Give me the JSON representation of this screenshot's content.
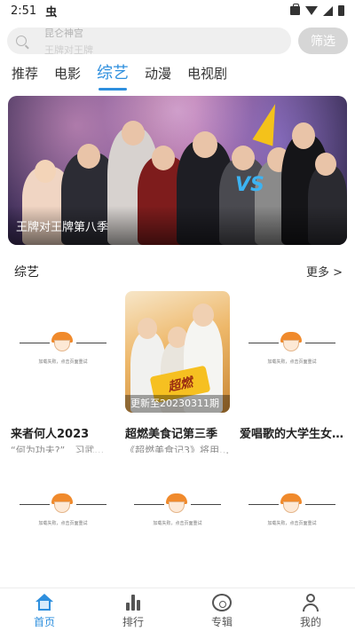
{
  "status_bar": {
    "time": "2:51",
    "app_glyph": "虫"
  },
  "search": {
    "hint_primary": "昆仑神宫",
    "hint_secondary": "王牌对王牌",
    "filter_label": "筛选"
  },
  "tabs": [
    {
      "label": "推荐",
      "active": false
    },
    {
      "label": "电影",
      "active": false
    },
    {
      "label": "综艺",
      "active": true
    },
    {
      "label": "动漫",
      "active": false
    },
    {
      "label": "电视剧",
      "active": false
    }
  ],
  "banner": {
    "caption": "王牌对王牌第八季",
    "vs_text": "VS"
  },
  "section": {
    "title": "综艺",
    "more": "更多 >"
  },
  "placeholder": {
    "text": "加载失败，点击页面重试"
  },
  "items": [
    {
      "title": "来者何人2023",
      "subtitle": "“何为功夫?”　习武…",
      "image": "placeholder"
    },
    {
      "title": "超燃美食记第三季",
      "subtitle": "《超燃美食记3》将用…",
      "image": "poster",
      "update": "更新至20230311期",
      "poster_logo": "超燃"
    },
    {
      "title": "爱唱歌的大学生女…",
      "subtitle": "",
      "image": "placeholder"
    },
    {
      "title": "",
      "subtitle": "",
      "image": "placeholder"
    },
    {
      "title": "",
      "subtitle": "",
      "image": "placeholder"
    },
    {
      "title": "",
      "subtitle": "",
      "image": "placeholder"
    }
  ],
  "bottom_nav": [
    {
      "label": "首页",
      "icon": "home-icon",
      "active": true
    },
    {
      "label": "排行",
      "icon": "ranking-icon",
      "active": false
    },
    {
      "label": "专辑",
      "icon": "album-icon",
      "active": false
    },
    {
      "label": "我的",
      "icon": "profile-icon",
      "active": false
    }
  ],
  "colors": {
    "accent": "#2e8fde",
    "filter_button": "#d6d6d6",
    "search_bg": "#efefef"
  }
}
